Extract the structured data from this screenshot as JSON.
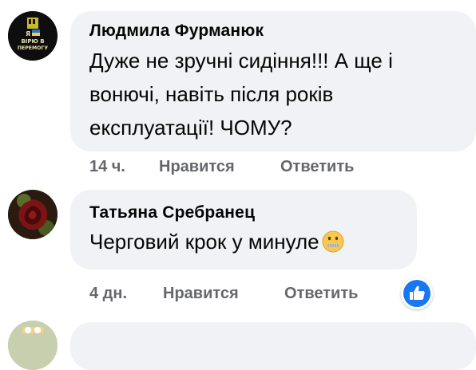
{
  "comments": [
    {
      "author": "Людмила Фурманюк",
      "avatar_text": [
        "Я",
        "ВІРЮ В",
        "ПЕРЕМОГУ"
      ],
      "lines": [
        "Дуже не зручні сидіння!!! А ще і",
        "вонючі, навіть після років",
        "експлуатації! ЧОМУ?"
      ],
      "time": "14 ч.",
      "like": "Нравится",
      "reply": "Ответить"
    },
    {
      "author": "Татьяна Сребранец",
      "lines": [
        "Черговий крок у минуле"
      ],
      "emoji": "zipper-mouth-face",
      "time": "4 дн.",
      "like": "Нравится",
      "reply": "Ответить",
      "reaction": "like"
    }
  ],
  "colors": {
    "bubble": "#f0f2f5",
    "meta": "#65676b",
    "like_blue": "#1877f2"
  }
}
